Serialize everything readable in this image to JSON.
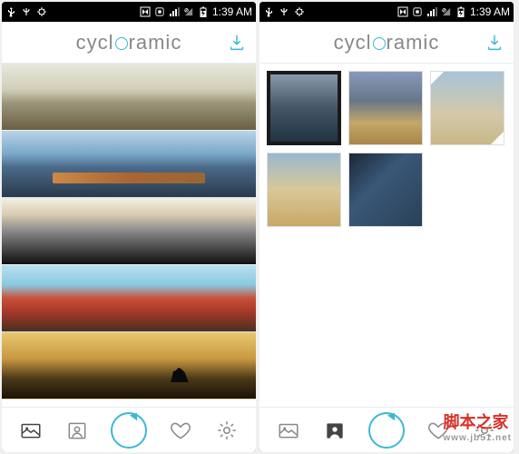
{
  "status": {
    "time": "1:39 AM"
  },
  "app": {
    "title_prefix": "cycl",
    "title_suffix": "ramic"
  },
  "nav": {
    "items": [
      "gallery",
      "portraits",
      "capture",
      "favorites",
      "settings"
    ]
  },
  "watermark": {
    "text": "脚本之家",
    "url": "www.jb51.net"
  }
}
